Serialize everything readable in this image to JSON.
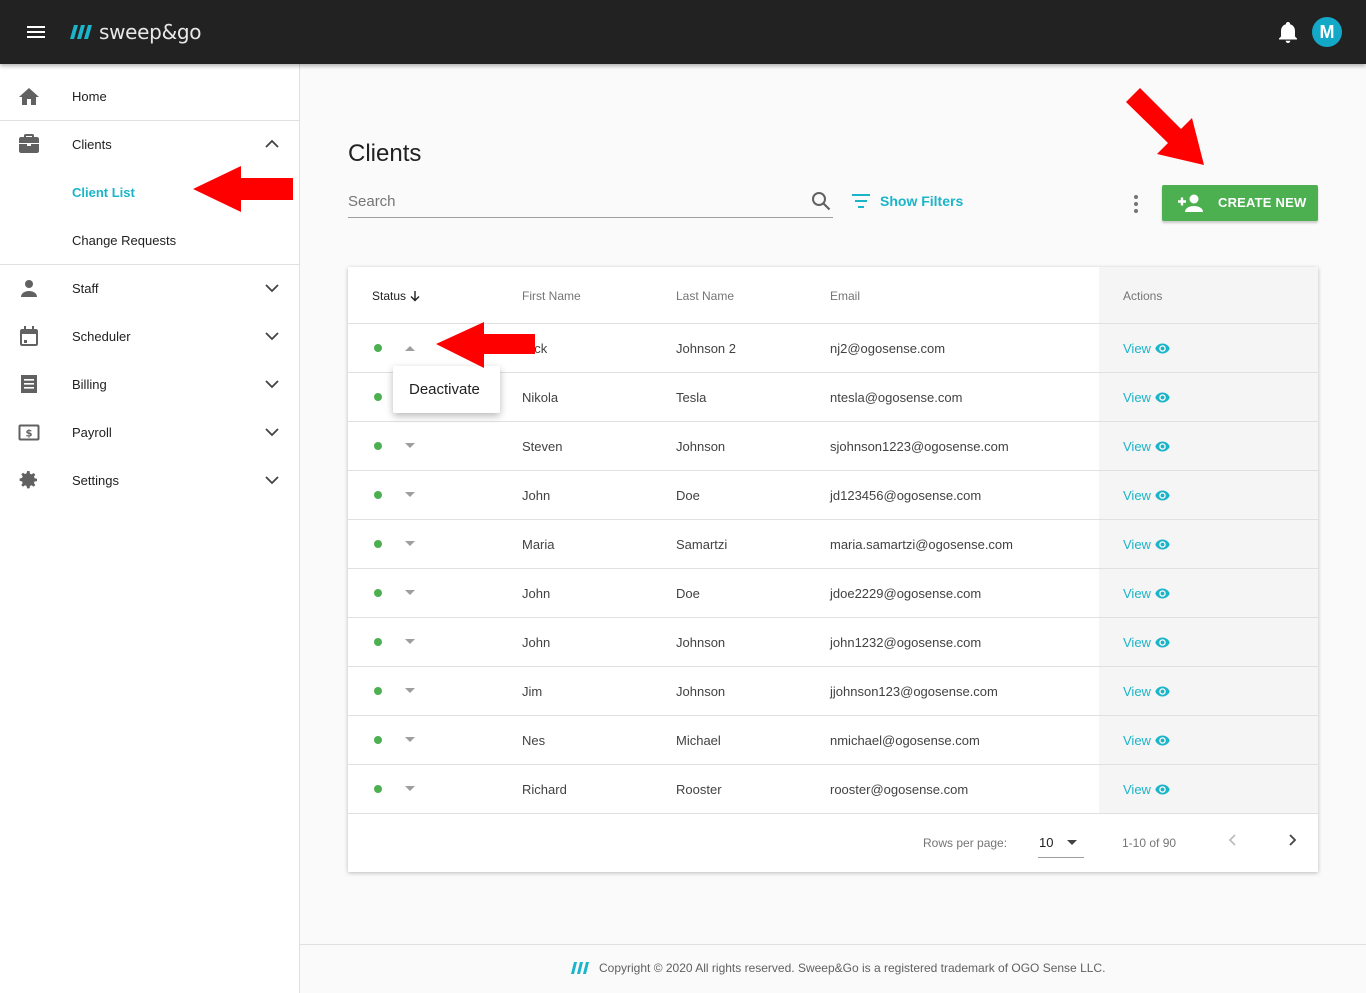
{
  "app": {
    "logo_text": "sweep&go",
    "avatar_initial": "M",
    "accent_color": "#1ab5c9",
    "header_color": "#222222"
  },
  "sidebar": {
    "items": [
      {
        "label": "Home",
        "icon": "home-icon"
      },
      {
        "label": "Clients",
        "icon": "briefcase-icon",
        "expanded": true
      },
      {
        "label": "Staff",
        "icon": "person-icon"
      },
      {
        "label": "Scheduler",
        "icon": "calendar-icon"
      },
      {
        "label": "Billing",
        "icon": "list-icon"
      },
      {
        "label": "Payroll",
        "icon": "money-icon"
      },
      {
        "label": "Settings",
        "icon": "gear-icon"
      }
    ],
    "clients_sub": [
      {
        "label": "Client List",
        "active": true
      },
      {
        "label": "Change Requests",
        "active": false
      }
    ]
  },
  "main": {
    "title": "Clients",
    "search_placeholder": "Search",
    "filters_label": "Show Filters",
    "create_label": "CREATE NEW"
  },
  "table": {
    "headers": {
      "status": "Status",
      "first_name": "First Name",
      "last_name": "Last Name",
      "email": "Email",
      "actions": "Actions"
    },
    "view_label": "View",
    "status_color": "#4caf50",
    "rows": [
      {
        "first": "Nick",
        "last": "Johnson 2",
        "email": "nj2@ogosense.com"
      },
      {
        "first": "Nikola",
        "last": "Tesla",
        "email": "ntesla@ogosense.com"
      },
      {
        "first": "Steven",
        "last": "Johnson",
        "email": "sjohnson1223@ogosense.com"
      },
      {
        "first": "John",
        "last": "Doe",
        "email": "jd123456@ogosense.com"
      },
      {
        "first": "Maria",
        "last": "Samartzi",
        "email": "maria.samartzi@ogosense.com"
      },
      {
        "first": "John",
        "last": "Doe",
        "email": "jdoe2229@ogosense.com"
      },
      {
        "first": "John",
        "last": "Johnson",
        "email": "john1232@ogosense.com"
      },
      {
        "first": "Jim",
        "last": "Johnson",
        "email": "jjohnson123@ogosense.com"
      },
      {
        "first": "Nes",
        "last": "Michael",
        "email": "nmichael@ogosense.com"
      },
      {
        "first": "Richard",
        "last": "Rooster",
        "email": "rooster@ogosense.com"
      }
    ],
    "pagination": {
      "rows_per_page_label": "Rows per page:",
      "rows_per_page": "10",
      "range": "1-10 of 90"
    }
  },
  "popup": {
    "label": "Deactivate"
  },
  "footer": {
    "copyright": "Copyright © 2020 All rights reserved. Sweep&Go is a registered trademark of OGO Sense LLC."
  }
}
